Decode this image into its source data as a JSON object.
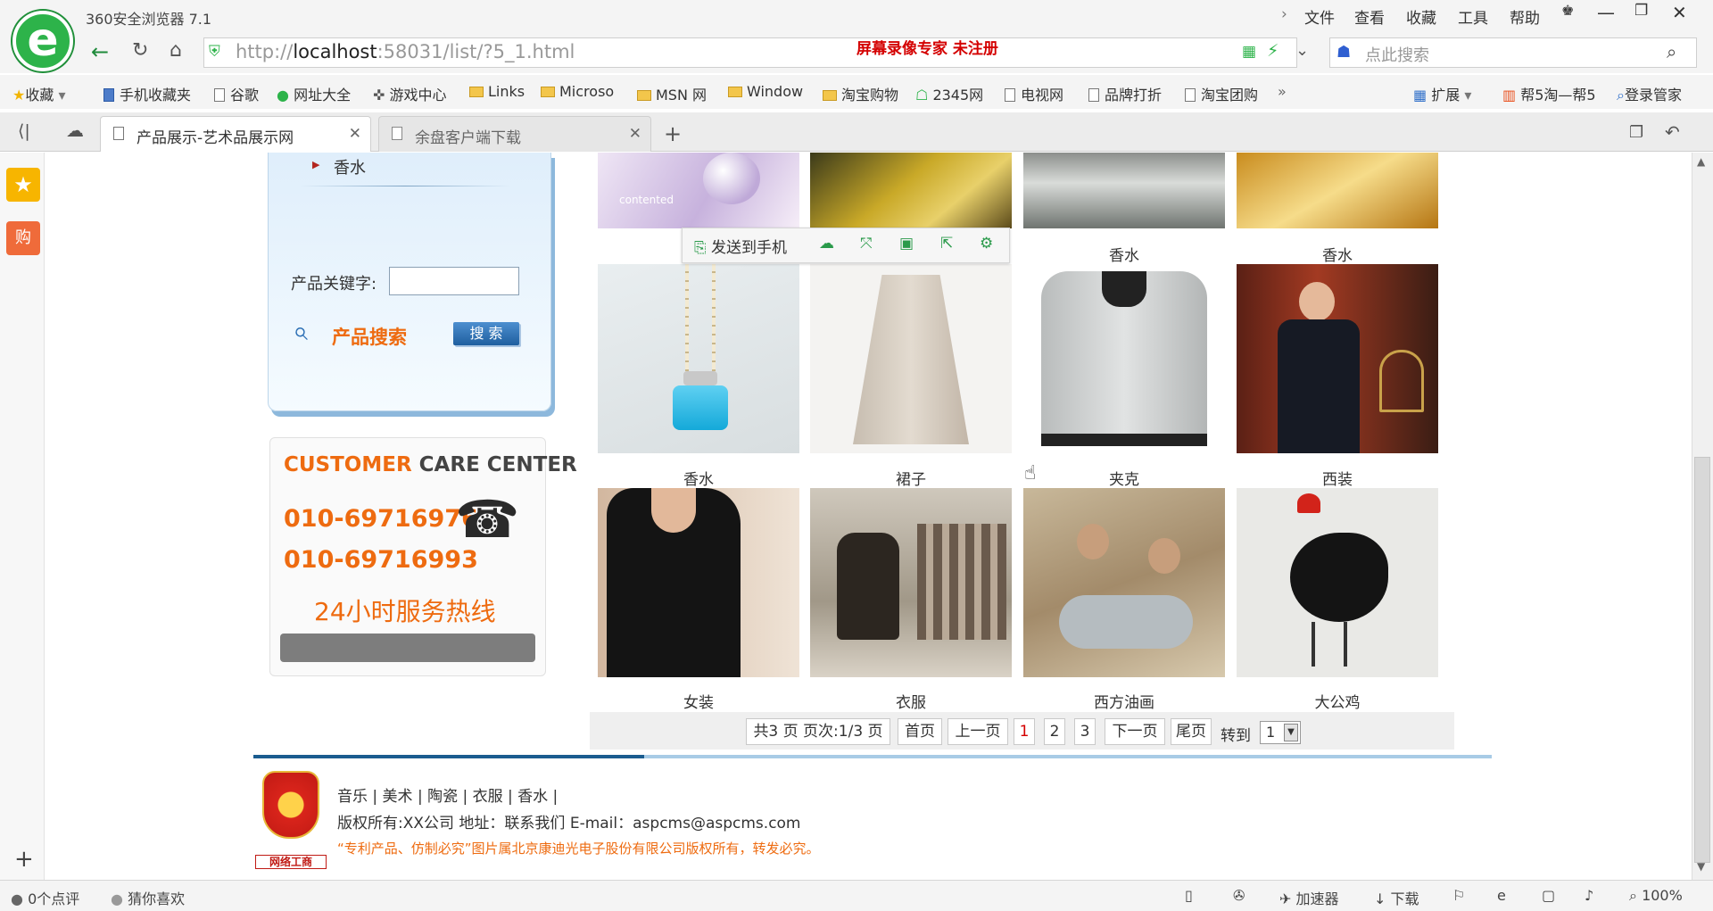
{
  "browser": {
    "app_title": "360安全浏览器 7.1",
    "menu": [
      "文件",
      "查看",
      "收藏",
      "工具",
      "帮助"
    ],
    "url_prefix": "http://",
    "url_host": "localhost",
    "url_rest": ":58031/list/?5_1.html",
    "recorder_watermark": "屏幕录像专家 未注册",
    "search_placeholder": "点此搜索",
    "bookmarks": [
      "收藏",
      "手机收藏夹",
      "谷歌",
      "网址大全",
      "游戏中心",
      "Links",
      "Microso",
      "MSN 网",
      "Window",
      "淘宝购物",
      "2345网",
      "电视网",
      "品牌打折",
      "淘宝团购"
    ],
    "bookmark_right": [
      "扩展",
      "帮5淘—帮5",
      "登录管家"
    ],
    "tabs": [
      {
        "label": "产品展示-艺术品展示网"
      },
      {
        "label": "余盘客户端下载"
      }
    ],
    "status": {
      "reviews": "0个点评",
      "guess": "猜你喜欢",
      "accelerator": "加速器",
      "download": "下载",
      "zoom": "100%"
    }
  },
  "sidebar": {
    "category_item": "香水",
    "keyword_label": "产品关键字:",
    "keyword_value": "",
    "product_search_label": "产品搜索",
    "search_button": "搜 索"
  },
  "care": {
    "title_accent": "CUSTOMER",
    "title_rest": " CARE CENTER",
    "phone1": "010-69716976",
    "phone2": "010-69716993",
    "hotline": "24小时服务热线"
  },
  "float_toolbar": {
    "send_to_phone": "发送到手机"
  },
  "products": {
    "row0_captions": [
      "",
      "",
      "香水",
      "香水"
    ],
    "row1_captions": [
      "香水",
      "裙子",
      "夹克",
      "西装"
    ],
    "row2_captions": [
      "女装",
      "衣服",
      "西方油画",
      "大公鸡"
    ],
    "row0_image_text": "contented"
  },
  "pager": {
    "summary": "共3 页 页次:1/3 页",
    "first": "首页",
    "prev": "上一页",
    "pages": [
      "1",
      "2",
      "3"
    ],
    "next": "下一页",
    "last": "尾页",
    "goto_label": "转到",
    "goto_value": "1"
  },
  "footer": {
    "links": "音乐 | 美术 | 陶瓷 | 衣服 | 香水 |",
    "copyright": "版权所有:XX公司  地址：联系我们  E-mail：aspcms@aspcms.com",
    "notice": "“专利产品、仿制必究”图片属北京康迪光电子股份有限公司版权所有，转发必究。",
    "badge_text": "网络工商"
  },
  "colors": {
    "accent_orange": "#ee6b10",
    "link_red": "#d40000",
    "brand_green": "#2db34a",
    "footer_blue": "#1a5c8f"
  }
}
